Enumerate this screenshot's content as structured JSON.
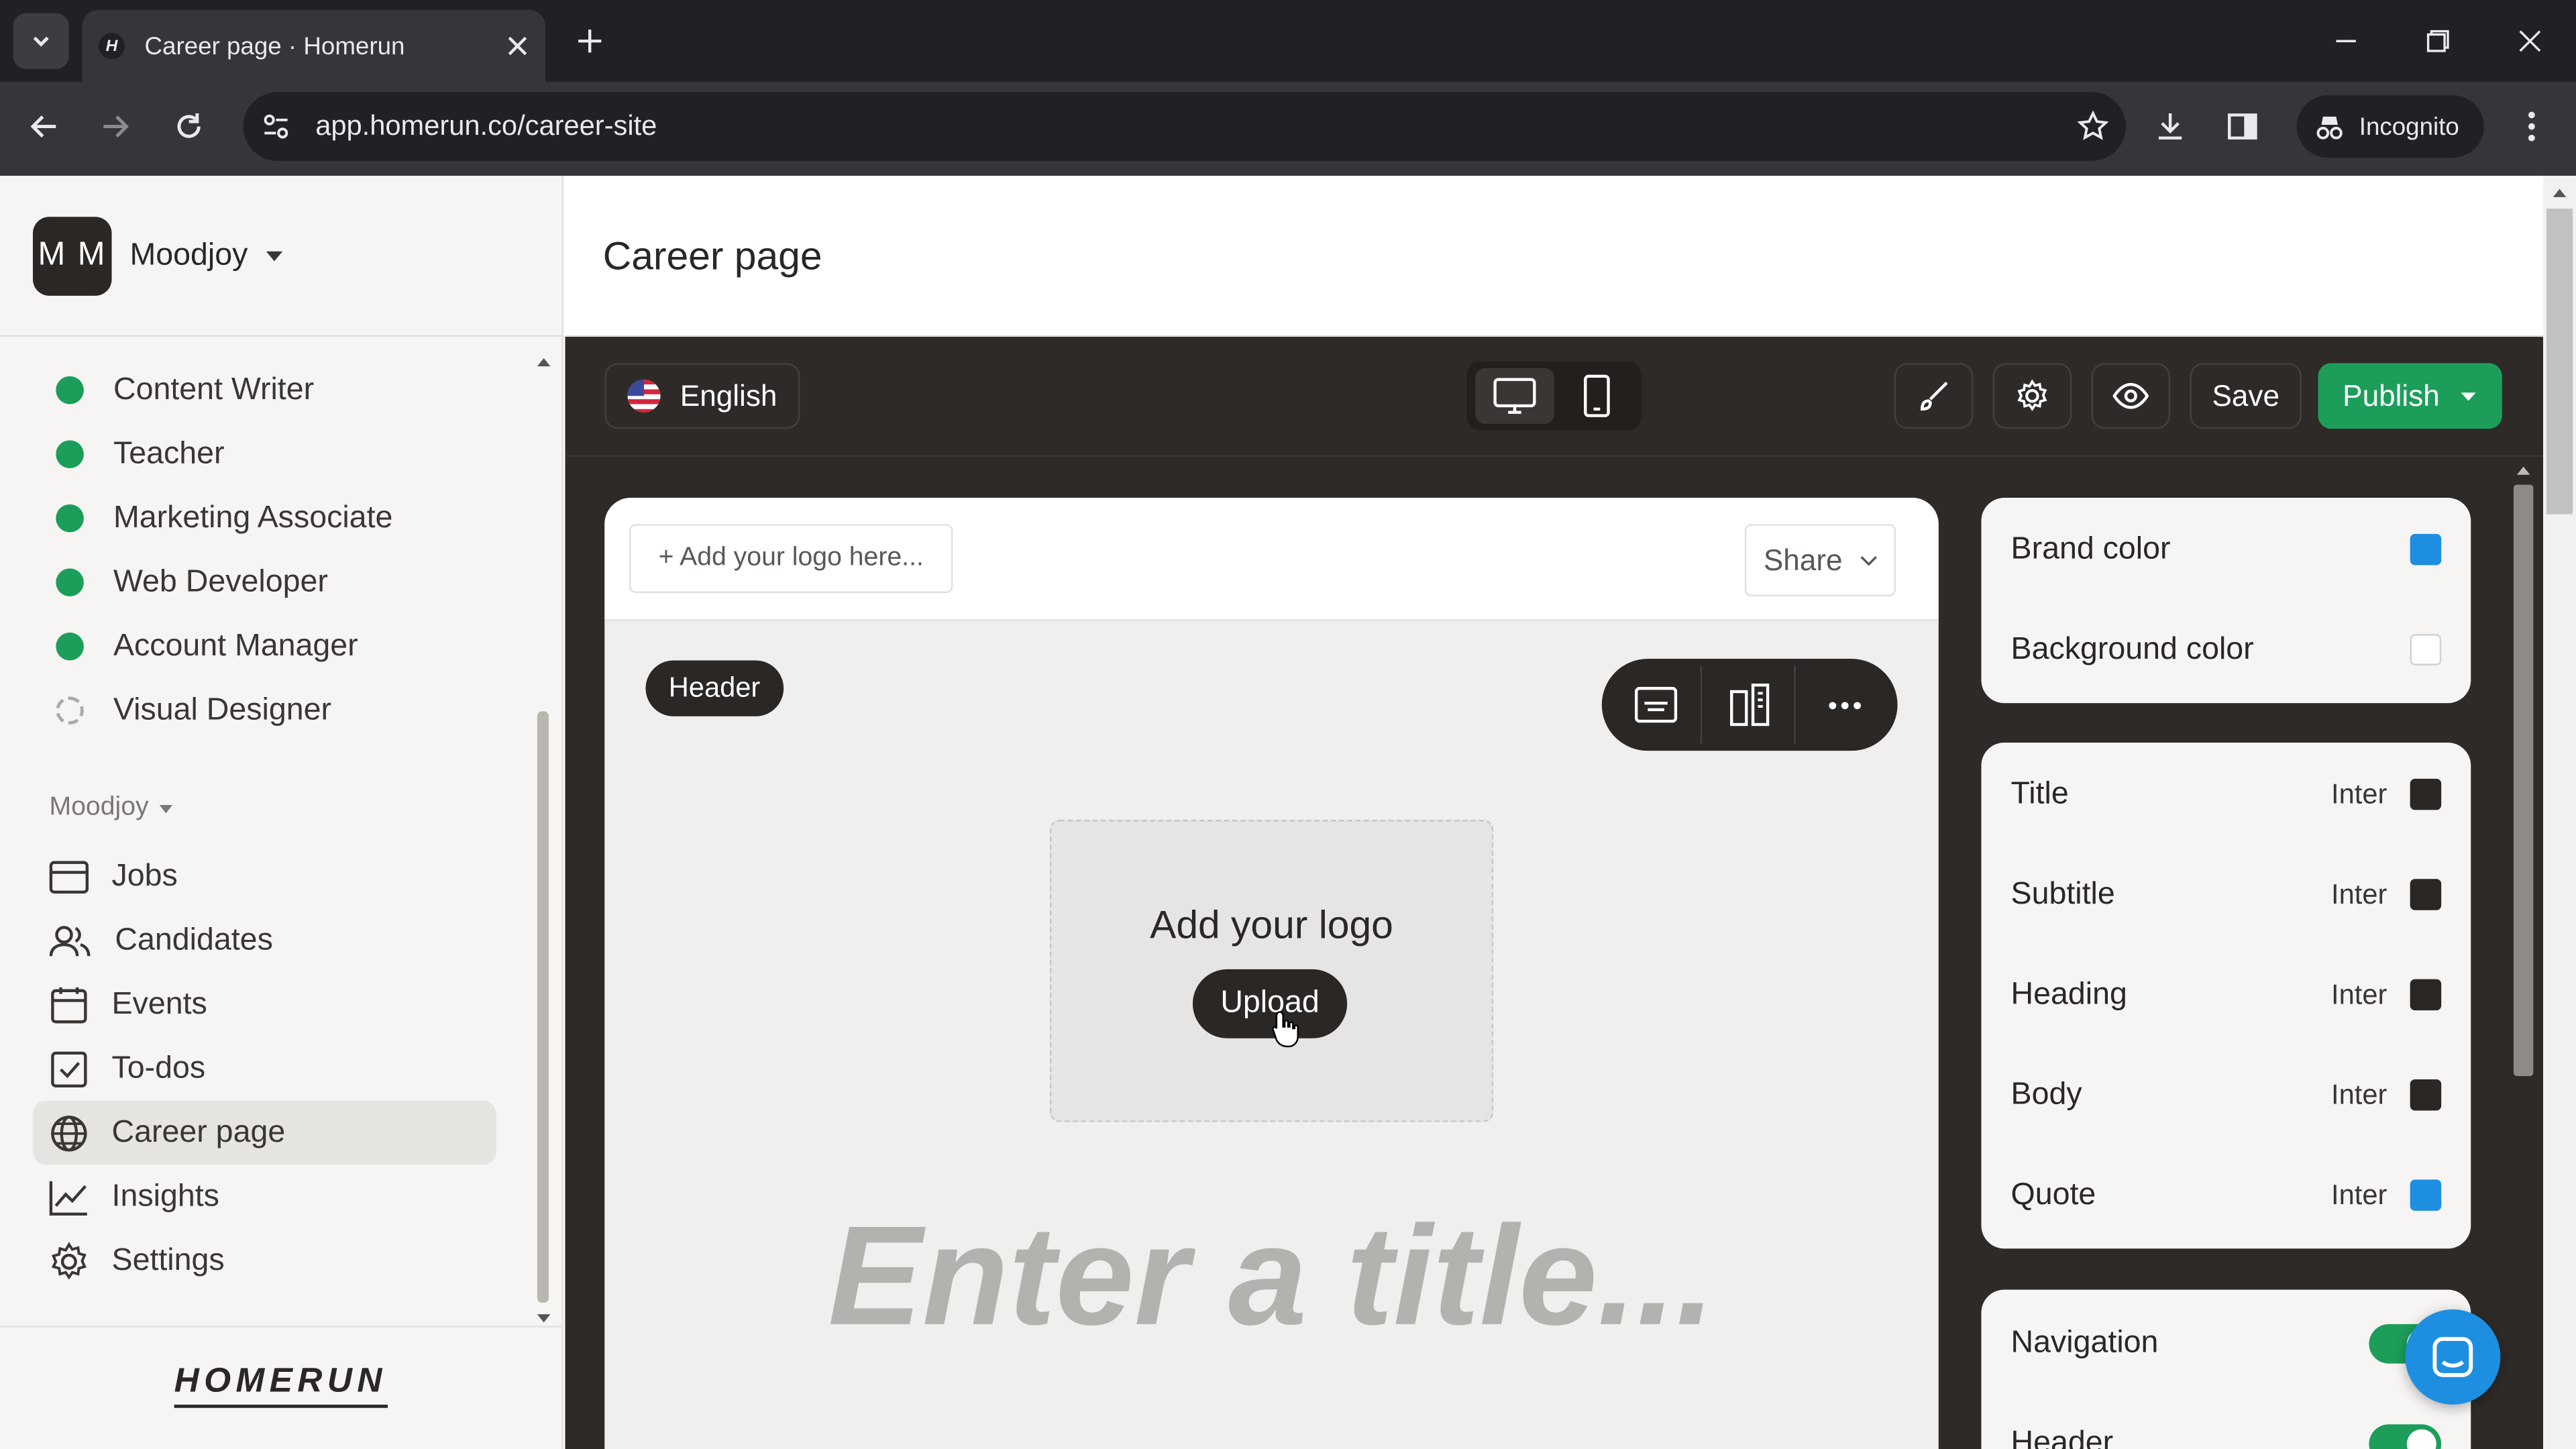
{
  "browser": {
    "tab_title": "Career page · Homerun",
    "favicon_letter": "H",
    "url": "app.homerun.co/career-site",
    "incognito_label": "Incognito"
  },
  "sidebar": {
    "workspace_initials": "M M",
    "workspace_name": "Moodjoy",
    "jobs": [
      {
        "label": "Content Writer",
        "status": "published"
      },
      {
        "label": "Teacher",
        "status": "published"
      },
      {
        "label": "Marketing Associate",
        "status": "published"
      },
      {
        "label": "Web Developer",
        "status": "published"
      },
      {
        "label": "Account Manager",
        "status": "published"
      },
      {
        "label": "Visual Designer",
        "status": "draft"
      }
    ],
    "section_label": "Moodjoy",
    "nav": [
      {
        "label": "Jobs",
        "icon": "briefcase-icon"
      },
      {
        "label": "Candidates",
        "icon": "users-icon"
      },
      {
        "label": "Events",
        "icon": "calendar-icon"
      },
      {
        "label": "To-dos",
        "icon": "checkbox-icon"
      },
      {
        "label": "Career page",
        "icon": "globe-icon",
        "active": true
      },
      {
        "label": "Insights",
        "icon": "chart-line-icon"
      },
      {
        "label": "Settings",
        "icon": "gear-icon"
      }
    ],
    "brand_logo": "HOMERUN"
  },
  "page": {
    "title": "Career page"
  },
  "editor": {
    "language": "English",
    "save_label": "Save",
    "publish_label": "Publish",
    "accent_green": "#1c9e5a"
  },
  "canvas": {
    "logo_placeholder": "+ Add your logo here...",
    "share_label": "Share",
    "section_badge": "Header",
    "add_logo_label": "Add your logo",
    "upload_label": "Upload",
    "title_placeholder": "Enter a title..."
  },
  "properties": {
    "colors": [
      {
        "label": "Brand color",
        "value": "#1e8fe0"
      },
      {
        "label": "Background color",
        "value": "#ffffff"
      }
    ],
    "fonts": [
      {
        "label": "Title",
        "font": "Inter",
        "color": "#2a2725"
      },
      {
        "label": "Subtitle",
        "font": "Inter",
        "color": "#2a2725"
      },
      {
        "label": "Heading",
        "font": "Inter",
        "color": "#2a2725"
      },
      {
        "label": "Body",
        "font": "Inter",
        "color": "#2a2725"
      },
      {
        "label": "Quote",
        "font": "Inter",
        "color": "#1e8fe0"
      }
    ],
    "toggles": [
      {
        "label": "Navigation",
        "on": true
      },
      {
        "label": "Header",
        "on": true
      }
    ]
  }
}
